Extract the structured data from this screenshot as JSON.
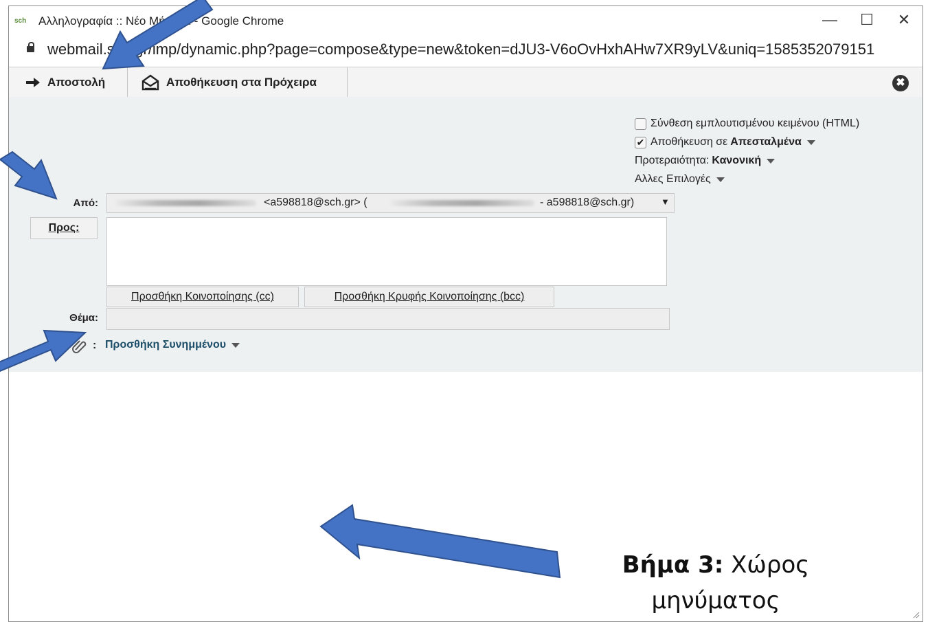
{
  "window": {
    "logo": "sch",
    "title": "Αλληλογραφία :: Νέο Μήνυμα - Google Chrome",
    "minimize": "—",
    "maximize": "☐",
    "close": "✕"
  },
  "address_bar": {
    "url": "webmail.sch.gr/imp/dynamic.php?page=compose&type=new&token=dJU3-V6oOvHxhAHw7XR9yLV&uniq=1585352079151"
  },
  "toolbar": {
    "send_label": "Αποστολή",
    "save_draft_label": "Αποθήκευση στα Πρόχειρα",
    "close_symbol": "✖"
  },
  "options": {
    "html_compose": "Σύνθεση εμπλουτισμένου κειμένου (HTML)",
    "save_in_prefix": "Αποθήκευση σε ",
    "save_in_value": "Απεσταλμένα",
    "priority_prefix": "Προτεραιότητα: ",
    "priority_value": "Κανονική",
    "other_options": "Αλλες Επιλογές"
  },
  "form": {
    "from_label": "Από:",
    "from_email": "<a598818@sch.gr> (",
    "from_email_tail": "- a598818@sch.gr)",
    "from_caret": "▼",
    "to_label": "Προς:",
    "add_cc": "Προσθήκη Κοινοποίησης (cc)",
    "add_bcc": "Προσθήκη Κρυφής Κοινοποίησης (bcc)",
    "subject_label": "Θέμα:",
    "attach_colon": ":",
    "add_attachment": "Προσθήκη Συνημμένου"
  },
  "annotation": {
    "step_bold": "Βήμα 3:",
    "step_text": " Χώρος",
    "step_line2": "μηνύματος"
  },
  "colors": {
    "arrow_fill": "#4472c4",
    "arrow_stroke": "#2f528f",
    "header_bg": "#eef1f1"
  }
}
